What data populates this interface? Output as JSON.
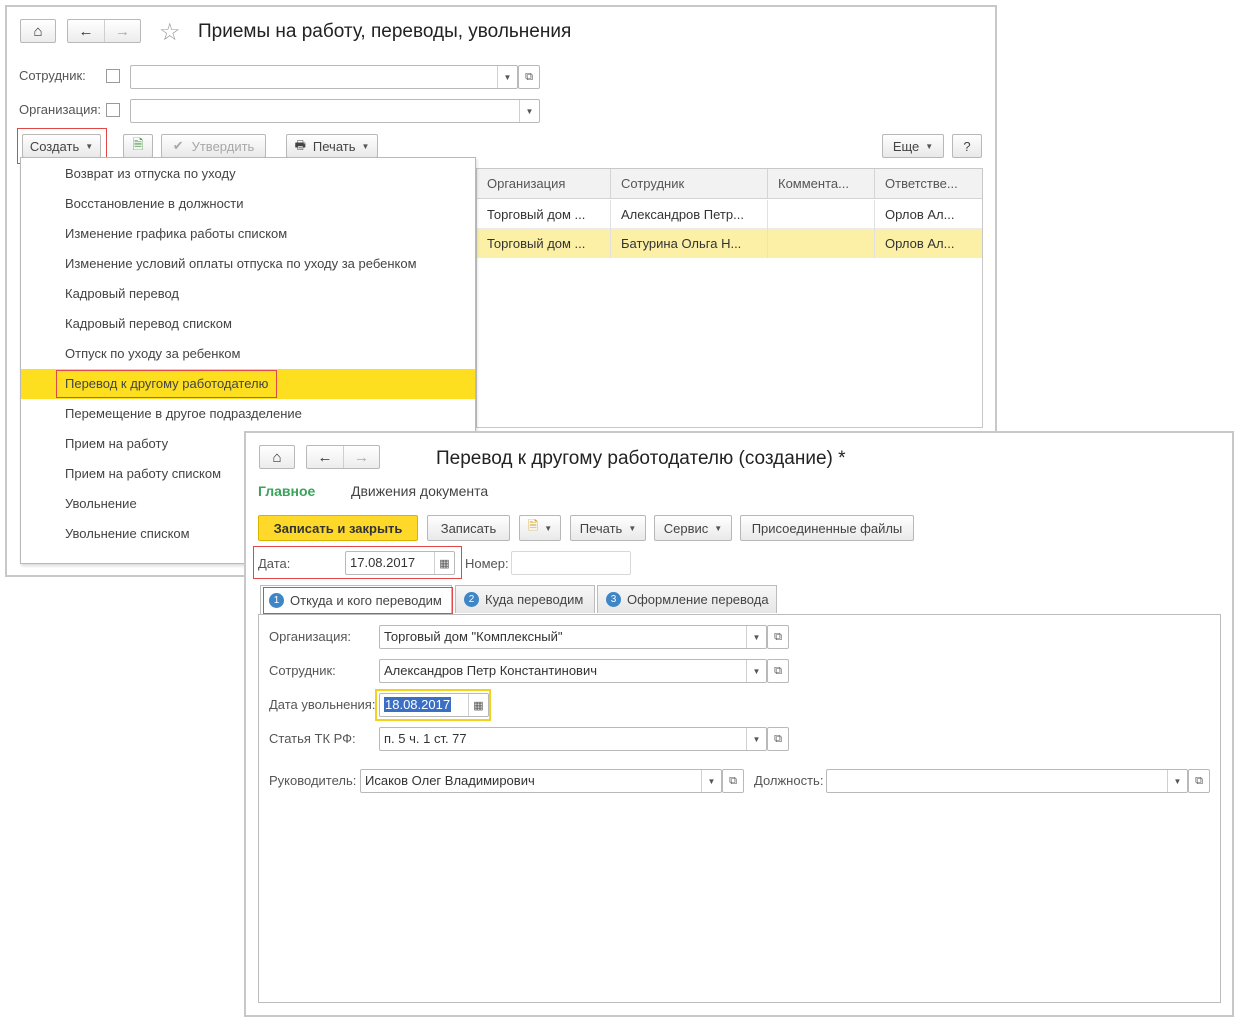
{
  "list_window": {
    "title": "Приемы на работу, переводы, увольнения",
    "filters": {
      "employee_label": "Сотрудник:",
      "employee_value": "",
      "organization_label": "Организация:",
      "organization_value": ""
    },
    "toolbar": {
      "create_label": "Создать",
      "approve_label": "Утвердить",
      "print_label": "Печать",
      "more_label": "Еще",
      "help_label": "?"
    },
    "create_menu": [
      "Возврат из отпуска по уходу",
      "Восстановление в должности",
      "Изменение графика работы списком",
      "Изменение условий оплаты отпуска по уходу за ребенком",
      "Кадровый перевод",
      "Кадровый перевод списком",
      "Отпуск по уходу за ребенком",
      "Перевод к другому работодателю",
      "Перемещение в другое подразделение",
      "Прием на работу",
      "Прием на работу списком",
      "Увольнение",
      "Увольнение списком"
    ],
    "selected_menu_index": 7,
    "table": {
      "columns": [
        "Организация",
        "Сотрудник",
        "Коммента...",
        "Ответстве..."
      ],
      "rows": [
        [
          "Торговый дом ...",
          "Александров Петр...",
          "",
          "Орлов Ал..."
        ],
        [
          "Торговый дом ...",
          "Батурина Ольга Н...",
          "",
          "Орлов Ал..."
        ]
      ],
      "selected_row_index": 1
    }
  },
  "doc_window": {
    "title": "Перевод к другому работодателю (создание) *",
    "nav": {
      "main_label": "Главное",
      "movements_label": "Движения документа"
    },
    "toolbar": {
      "save_close_label": "Записать и закрыть",
      "save_label": "Записать",
      "print_label": "Печать",
      "service_label": "Сервис",
      "attached_label": "Присоединенные файлы"
    },
    "date_label": "Дата:",
    "date_value": "17.08.2017",
    "number_label": "Номер:",
    "number_value": "",
    "tabs": [
      {
        "num": "1",
        "label": "Откуда и кого переводим"
      },
      {
        "num": "2",
        "label": "Куда переводим"
      },
      {
        "num": "3",
        "label": "Оформление перевода"
      }
    ],
    "form": {
      "org_label": "Организация:",
      "org_value": "Торговый дом \"Комплексный\"",
      "emp_label": "Сотрудник:",
      "emp_value": "Александров Петр Константинович",
      "dismissal_label": "Дата увольнения:",
      "dismissal_value": "18.08.2017",
      "article_label": "Статья ТК РФ:",
      "article_value": "п. 5 ч. 1 ст. 77",
      "manager_label": "Руководитель:",
      "manager_value": "Исаков Олег Владимирович",
      "position_label": "Должность:",
      "position_value": ""
    }
  },
  "colors": {
    "accent_yellow": "#fddf1f",
    "selection_row": "#fbf0a6",
    "highlight_red": "#e04848",
    "tab_number_blue": "#3f86c7",
    "main_tab_green": "#3aa25a"
  }
}
